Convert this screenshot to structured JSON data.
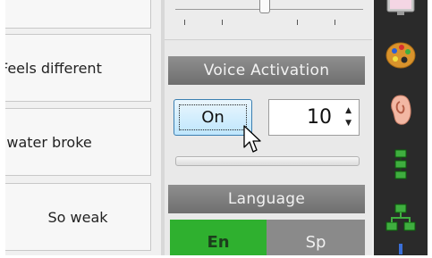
{
  "phrases": [
    {
      "label": "Feels different"
    },
    {
      "label": "My water broke"
    },
    {
      "label": "So weak"
    }
  ],
  "voice_activation": {
    "header": "Voice Activation",
    "toggle_label": "On",
    "level_value": "10",
    "spinner_arrows": "▲\n▼"
  },
  "language": {
    "header": "Language",
    "options": [
      "En",
      "Sp"
    ],
    "selected": "En"
  },
  "toolbar": {
    "icons": [
      "monitor-icon",
      "palette-icon",
      "ear-icon",
      "list-icon",
      "hierarchy-icon"
    ]
  },
  "colors": {
    "language_selected": "#2fb02f",
    "header_bg": "#7a7a7a",
    "toolbar_bg": "#2a2a2a"
  }
}
